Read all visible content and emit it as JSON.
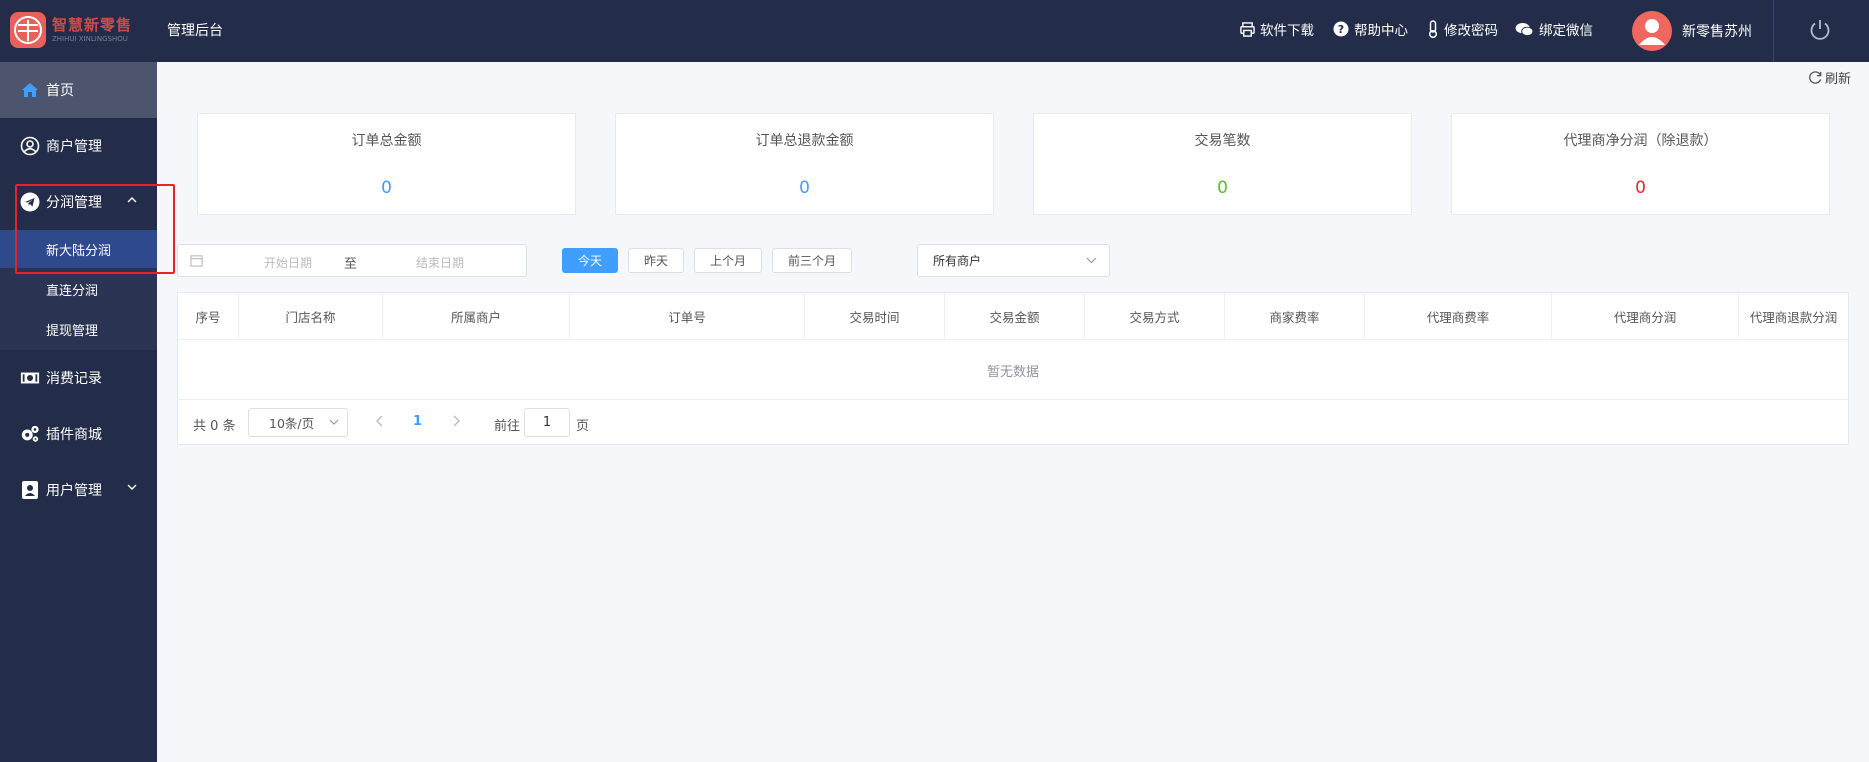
{
  "header": {
    "logo_text": "智慧新零售",
    "logo_subtext": "ZHIHUI XINLINGSHOU",
    "title": "管理后台",
    "nav": [
      {
        "label": "软件下载",
        "icon": "printer-icon"
      },
      {
        "label": "帮助中心",
        "icon": "question-circle-icon"
      },
      {
        "label": "修改密码",
        "icon": "thermometer-icon"
      },
      {
        "label": "绑定微信",
        "icon": "chat-bubbles-icon"
      }
    ],
    "username": "新零售苏州"
  },
  "sidebar": {
    "items": [
      {
        "label": "首页",
        "icon": "home-icon"
      },
      {
        "label": "商户管理",
        "icon": "user-circle-icon"
      },
      {
        "label": "分润管理",
        "icon": "telegram-icon"
      },
      {
        "label": "消费记录",
        "icon": "money-icon"
      },
      {
        "label": "插件商城",
        "icon": "gears-icon"
      },
      {
        "label": "用户管理",
        "icon": "contact-book-icon"
      }
    ],
    "sub_items": [
      {
        "label": "新大陆分润"
      },
      {
        "label": "直连分润"
      },
      {
        "label": "提现管理"
      }
    ]
  },
  "toolbar": {
    "refresh_label": "刷新"
  },
  "stats": [
    {
      "label": "订单总金额",
      "value": "0",
      "color": "#409eff"
    },
    {
      "label": "订单总退款金额",
      "value": "0",
      "color": "#409eff"
    },
    {
      "label": "交易笔数",
      "value": "0",
      "color": "#52c41a"
    },
    {
      "label": "代理商净分润（除退款）",
      "value": "0",
      "color": "#f5222d"
    }
  ],
  "filters": {
    "start_placeholder": "开始日期",
    "separator": "至",
    "end_placeholder": "结束日期",
    "quick": [
      "今天",
      "昨天",
      "上个月",
      "前三个月"
    ],
    "merchant_select": "所有商户"
  },
  "table": {
    "columns": [
      "序号",
      "门店名称",
      "所属商户",
      "订单号",
      "交易时间",
      "交易金额",
      "交易方式",
      "商家费率",
      "代理商费率",
      "代理商分润",
      "代理商退款分润"
    ],
    "empty_text": "暂无数据"
  },
  "pagination": {
    "total_text": "共 0 条",
    "page_size": "10条/页",
    "current_page": "1",
    "goto_label": "前往",
    "goto_value": "1",
    "goto_suffix": "页"
  },
  "colors": {
    "header_bg": "#232c48",
    "primary": "#409eff",
    "highlight": "#e9222a"
  }
}
